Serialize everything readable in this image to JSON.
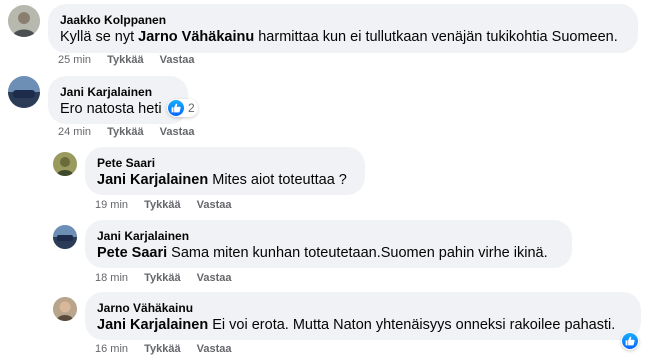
{
  "comments": [
    {
      "author": "Jaakko Kolppanen",
      "mention": "",
      "text_pre": "Kyllä se nyt ",
      "mention_inline": "Jarno Vähäkainu",
      "text_post": " harmittaa kun ei tullutkaan venäjän tukikohtia Suomeen.",
      "time": "25 min",
      "like_label": "Tykkää",
      "reply_label": "Vastaa"
    },
    {
      "author": "Jani Karjalainen",
      "text": "Ero natosta heti",
      "reaction_count": "2",
      "time": "24 min",
      "like_label": "Tykkää",
      "reply_label": "Vastaa"
    },
    {
      "author": "Pete Saari",
      "mention": "Jani Karjalainen",
      "text": " Mites aiot toteuttaa ?",
      "time": "19 min",
      "like_label": "Tykkää",
      "reply_label": "Vastaa"
    },
    {
      "author": "Jani Karjalainen",
      "mention": "Pete Saari",
      "text": " Sama miten kunhan toteutetaan.Suomen pahin virhe ikinä.",
      "time": "18 min",
      "like_label": "Tykkää",
      "reply_label": "Vastaa"
    },
    {
      "author": "Jarno Vähäkainu",
      "mention": "Jani Karjalainen",
      "text": " Ei voi erota. Mutta Naton yhtenäisyys onneksi rakoilee pahasti.",
      "time": "16 min",
      "like_label": "Tykkää",
      "reply_label": "Vastaa"
    }
  ],
  "icons": {
    "reaction": "like-icon",
    "avatar": "avatar"
  },
  "colors": {
    "bubble": "#f0f2f5",
    "meta": "#65676b",
    "like_blue": "#0866ff"
  }
}
